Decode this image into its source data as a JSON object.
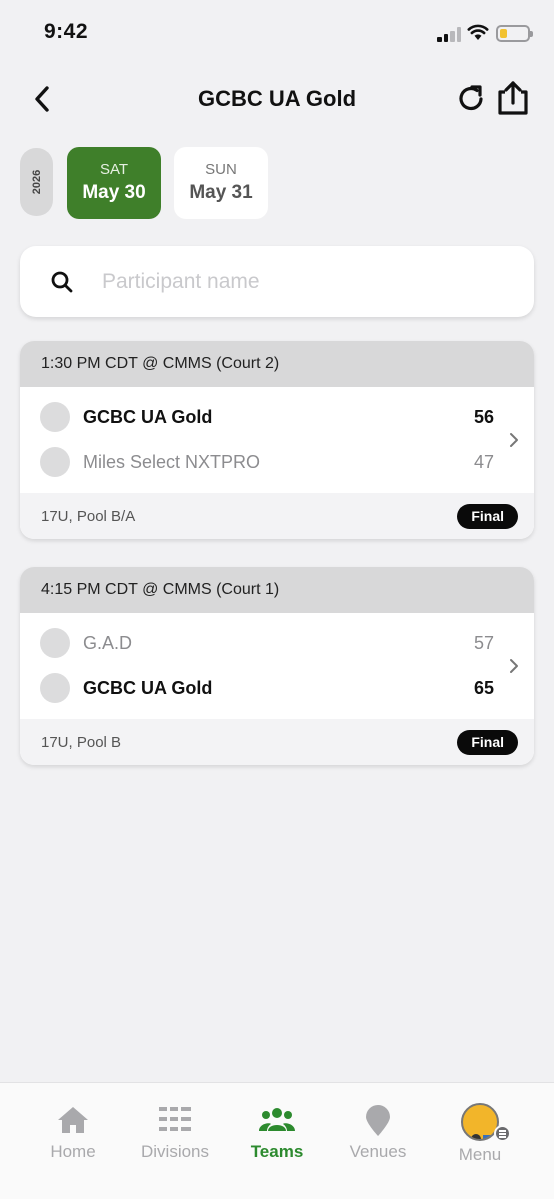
{
  "status_bar": {
    "time": "9:42"
  },
  "header": {
    "title": "GCBC UA Gold"
  },
  "dates": {
    "year": "2026",
    "days": [
      {
        "dow": "SAT",
        "date": "May 30",
        "selected": true
      },
      {
        "dow": "SUN",
        "date": "May 31",
        "selected": false
      }
    ]
  },
  "search": {
    "placeholder": "Participant name",
    "value": ""
  },
  "games": [
    {
      "header": "1:30 PM CDT @ CMMS (Court 2)",
      "teams": [
        {
          "name": "GCBC UA Gold",
          "score": "56",
          "winner": true
        },
        {
          "name": "Miles Select NXTPRO",
          "score": "47",
          "winner": false
        }
      ],
      "division": "17U, Pool B/A",
      "status": "Final"
    },
    {
      "header": "4:15 PM CDT @ CMMS (Court 1)",
      "teams": [
        {
          "name": "G.A.D",
          "score": "57",
          "winner": false
        },
        {
          "name": "GCBC UA Gold",
          "score": "65",
          "winner": true
        }
      ],
      "division": "17U, Pool B",
      "status": "Final"
    }
  ],
  "tabs": [
    {
      "label": "Home",
      "icon": "home-icon",
      "active": false
    },
    {
      "label": "Divisions",
      "icon": "divisions-icon",
      "active": false
    },
    {
      "label": "Teams",
      "icon": "teams-icon",
      "active": true
    },
    {
      "label": "Venues",
      "icon": "venue-pin-icon",
      "active": false
    },
    {
      "label": "Menu",
      "icon": "profile-avatar-icon",
      "active": false
    }
  ],
  "colors": {
    "accent": "#3f7f2a",
    "active_tab": "#2c8a2e",
    "badge": "#0a0a0a"
  }
}
